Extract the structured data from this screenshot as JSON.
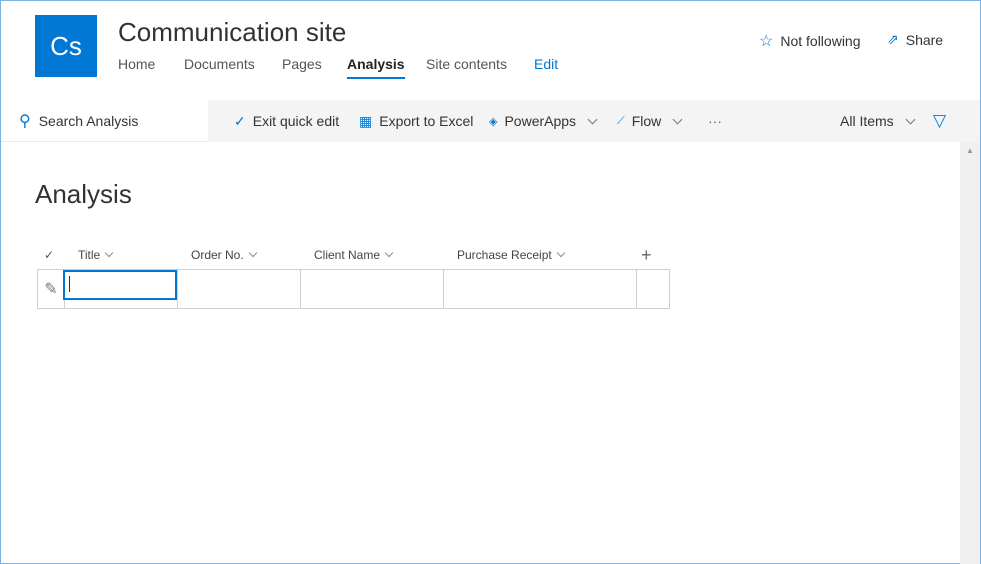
{
  "site": {
    "logo_text": "Cs",
    "title": "Communication site"
  },
  "nav": [
    "Home",
    "Documents",
    "Pages",
    "Analysis",
    "Site contents",
    "Edit"
  ],
  "header_actions": {
    "follow": "Not following",
    "share": "Share"
  },
  "toolbar": {
    "search_placeholder": "Search Analysis",
    "exit_quick_edit": "Exit quick edit",
    "export": "Export to Excel",
    "powerapps": "PowerApps",
    "flow": "Flow",
    "more": "···",
    "view": "All Items"
  },
  "list": {
    "title": "Analysis",
    "columns": [
      "Title",
      "Order No.",
      "Client Name",
      "Purchase Receipt"
    ],
    "add_column": "+"
  },
  "colors": {
    "accent": "#0078d4"
  }
}
